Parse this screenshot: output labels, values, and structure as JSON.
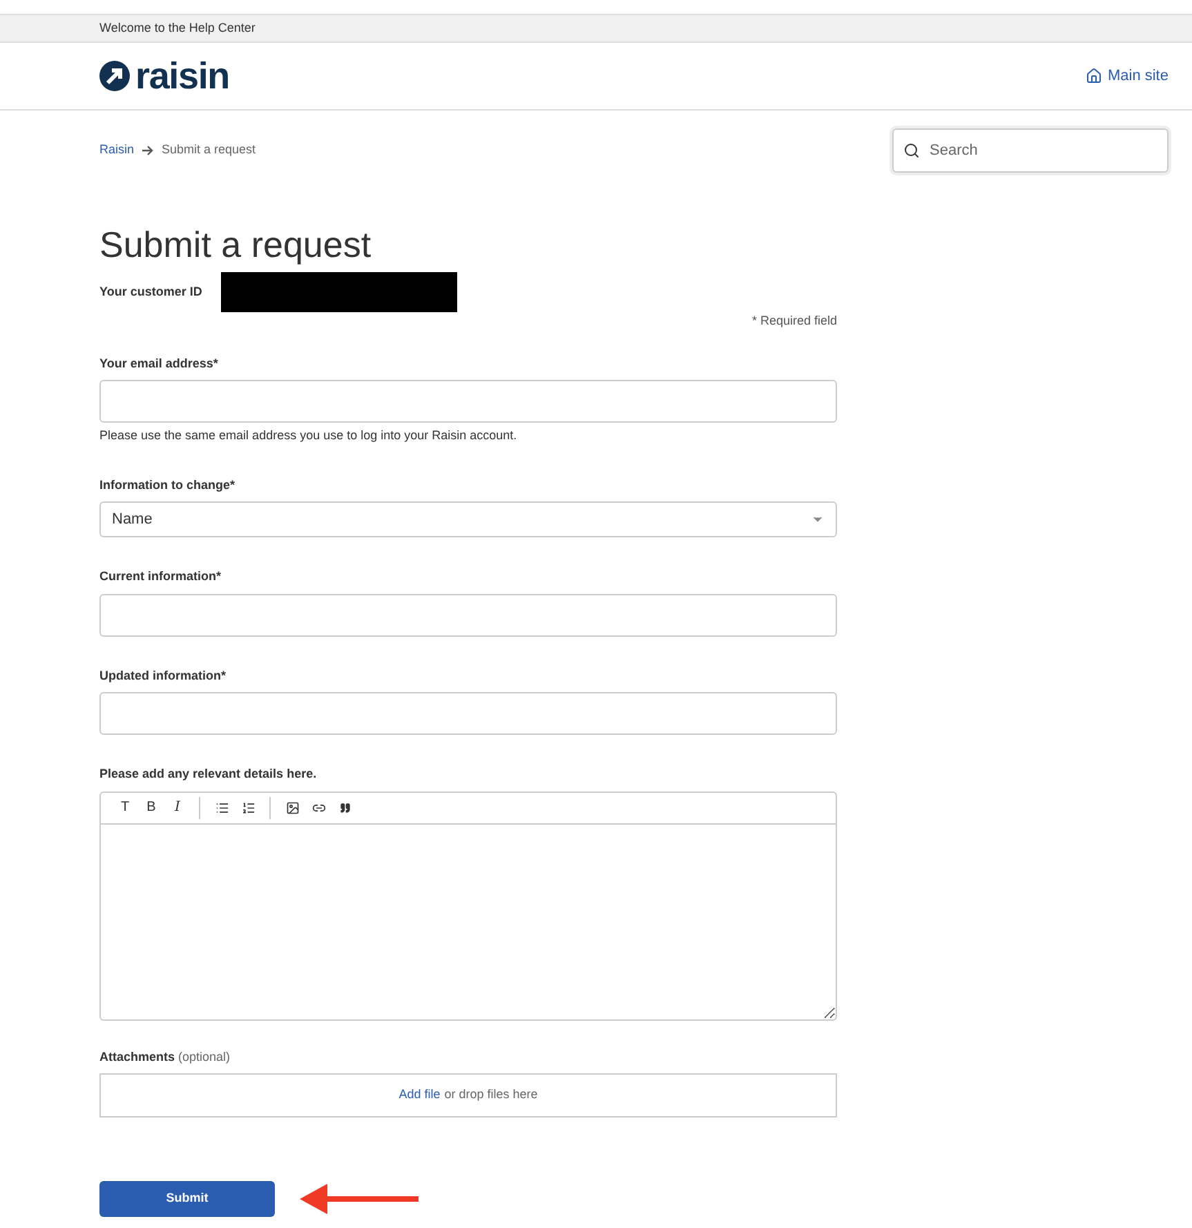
{
  "top_bar": {
    "text": "Welcome to the Help Center"
  },
  "header": {
    "logo_text": "raisin",
    "main_site_link": "Main site"
  },
  "breadcrumbs": [
    {
      "label": "Raisin"
    },
    {
      "label": "Submit a request"
    }
  ],
  "search": {
    "placeholder": "Search"
  },
  "page_title": "Submit a request",
  "customer_id": {
    "label": "Your customer ID"
  },
  "required_note": "* Required field",
  "fields": [
    {
      "kind": "input",
      "label": "Your email address*",
      "hint": "Please use the same email address you use to log into your Raisin account."
    },
    {
      "kind": "select",
      "label": "Information to change*",
      "value": "Name"
    },
    {
      "kind": "input",
      "label": "Current information*"
    },
    {
      "kind": "input",
      "label": "Updated information*"
    }
  ],
  "details": {
    "label": "Please add any relevant details here.",
    "toolbar": [
      {
        "kind": "text",
        "label": "T"
      },
      {
        "kind": "text",
        "label": "B"
      },
      {
        "kind": "italic-text",
        "label": "I"
      },
      {
        "kind": "divider"
      },
      {
        "kind": "bullet-list"
      },
      {
        "kind": "numbered-list"
      },
      {
        "kind": "divider"
      },
      {
        "kind": "image"
      },
      {
        "kind": "link"
      },
      {
        "kind": "quote"
      }
    ]
  },
  "attachments": {
    "label": "Attachments",
    "optional_note": "(optional)",
    "add_link": "Add file",
    "drop_text": "or drop files here"
  },
  "submit_button": "Submit"
}
